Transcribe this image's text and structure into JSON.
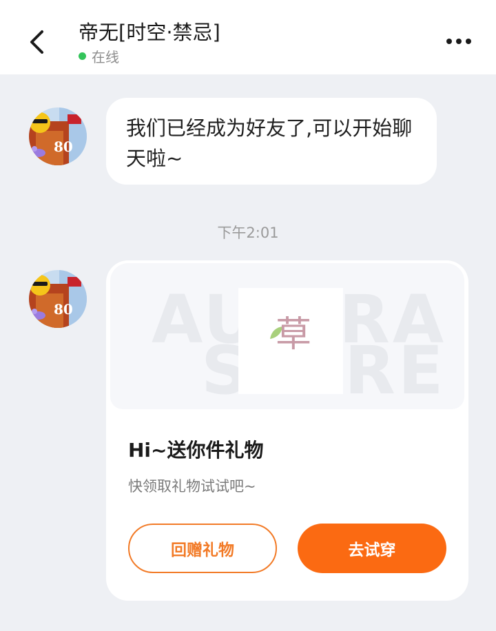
{
  "header": {
    "title": "帝无[时空·禁忌]",
    "status_text": "在线",
    "back_icon": "chevron-left-icon",
    "more_icon": "more-horizontal-icon"
  },
  "messages": {
    "system_text": "我们已经成为好友了,可以开始聊天啦~",
    "timestamp": "下午2:01"
  },
  "gift_card": {
    "banner_text_top": "AU",
    "banner_text_bottom": "S",
    "banner_text_right_top": "RA",
    "banner_text_right_bottom": "RE",
    "product_glyph": "草",
    "title": "Hi~送你件礼物",
    "subtitle": "快领取礼物试试吧~",
    "return_gift_label": "回赠礼物",
    "try_on_label": "去试穿"
  },
  "colors": {
    "accent": "#fb6a12",
    "online": "#33c45a",
    "background": "#eef0f4"
  }
}
